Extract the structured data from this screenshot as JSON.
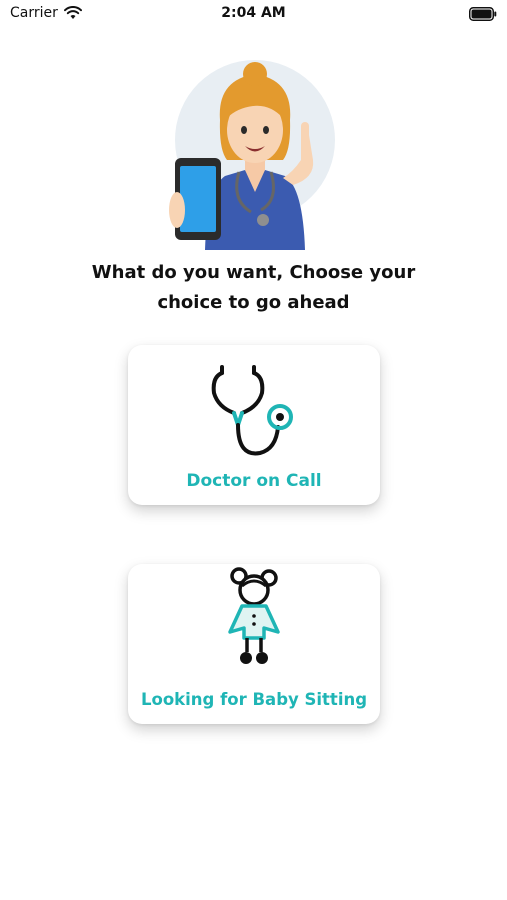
{
  "status_bar": {
    "carrier": "Carrier",
    "time": "2:04 AM",
    "icons": [
      "wifi-icon",
      "battery-icon"
    ]
  },
  "main": {
    "hero_icon": "nurse-holding-phone-illustration",
    "heading_line1": "What do you want, Choose your",
    "heading_line2": "choice to go ahead",
    "options": [
      {
        "label": "Doctor on Call",
        "icon": "stethoscope-icon"
      },
      {
        "label": "Looking for Baby Sitting",
        "icon": "baby-girl-icon"
      }
    ]
  },
  "colors": {
    "accent": "#1fb5b5",
    "heading": "#111111",
    "background": "#ffffff"
  }
}
